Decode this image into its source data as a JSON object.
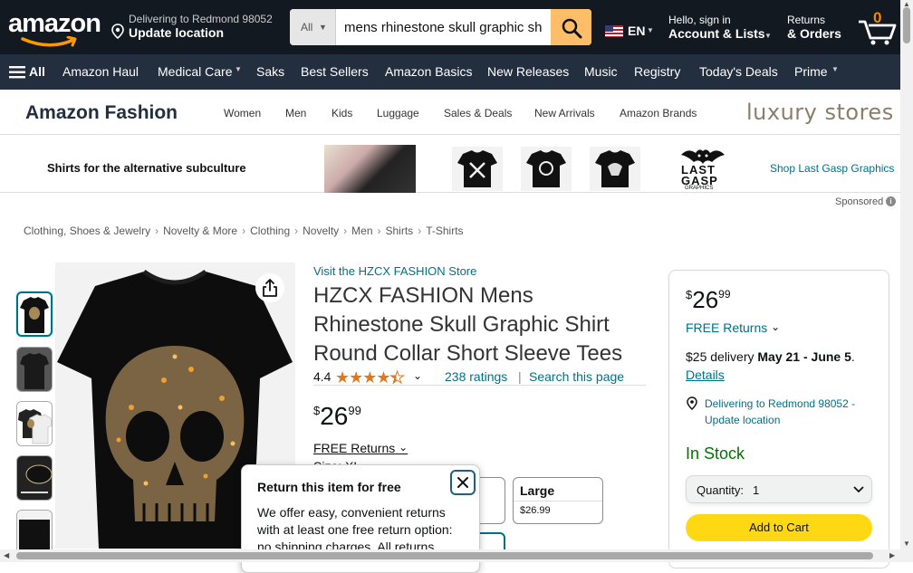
{
  "header": {
    "logo_text": "amazon",
    "deliver_line1": "Delivering to Redmond 98052",
    "deliver_line2": "Update location",
    "search_category": "All",
    "search_value": "mens rhinestone skull graphic sh",
    "lang": "EN",
    "account_line1": "Hello, sign in",
    "account_line2": "Account & Lists",
    "returns_line1": "Returns",
    "returns_line2": "& Orders",
    "cart_count": "0"
  },
  "subnav": {
    "all_label": "All",
    "items": [
      "Amazon Haul",
      "Medical Care",
      "Saks",
      "Best Sellers",
      "Amazon Basics",
      "New Releases",
      "Music",
      "Registry",
      "Today's Deals",
      "Prime"
    ]
  },
  "fashion": {
    "title": "Amazon Fashion",
    "links": [
      "Women",
      "Men",
      "Kids",
      "Luggage",
      "Sales & Deals",
      "New Arrivals",
      "Amazon Brands"
    ],
    "luxury": "luxury stores"
  },
  "banner": {
    "text": "Shirts for the alternative subculture",
    "brand_line1": "LAST",
    "brand_line2": "GASP",
    "brand_line3": "GRAPHICS",
    "shop_link": "Shop Last Gasp Graphics",
    "sponsored": "Sponsored"
  },
  "breadcrumbs": [
    "Clothing, Shoes & Jewelry",
    "Novelty & More",
    "Clothing",
    "Novelty",
    "Men",
    "Shirts",
    "T-Shirts"
  ],
  "product": {
    "store_link": "Visit the HZCX FASHION Store",
    "title": "HZCX FASHION Mens Rhinestone Skull Graphic Shirt Round Collar Short Sleeve Tees",
    "rating": "4.4",
    "rating_value": 4.4,
    "ratings_count": "238 ratings",
    "search_page": "Search this page",
    "price_symbol": "$",
    "price_whole": "26",
    "price_fraction": "99",
    "free_returns": "FREE Returns",
    "size_hint": "Size: XL"
  },
  "size_options": [
    {
      "name": "Large",
      "price": "$26.99"
    }
  ],
  "popover": {
    "heading": "Return this item for free",
    "body": "We offer easy, convenient returns with at least one free return option: no shipping charges. All returns"
  },
  "buybox": {
    "price_symbol": "$",
    "price_whole": "26",
    "price_fraction": "99",
    "free_returns": "FREE Returns",
    "delivery_prefix": "$25 delivery ",
    "delivery_dates": "May 21 - June 5",
    "delivery_suffix": ".",
    "details": "Details",
    "location": "Delivering to Redmond 98052 - Update location",
    "stock": "In Stock",
    "qty_label": "Quantity:",
    "qty_value": "1",
    "add_to_cart": "Add to Cart"
  },
  "colors": {
    "nav_dark": "#131921",
    "nav_sub": "#232f3e",
    "search_button": "#febd69",
    "link": "#007185",
    "star": "#de7921",
    "in_stock": "#007600",
    "add_to_cart": "#ffd814"
  }
}
